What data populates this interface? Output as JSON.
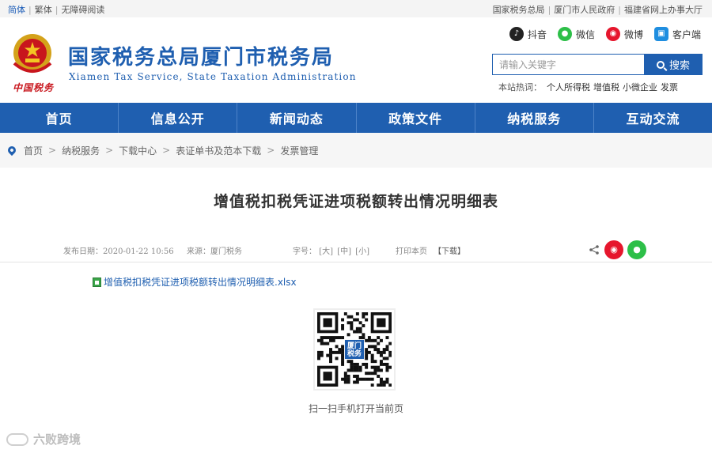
{
  "topbar": {
    "left_links": [
      "简体",
      "繁体",
      "无障碍阅读"
    ],
    "right_links": [
      "国家税务总局",
      "厦门市人民政府",
      "福建省网上办事大厅"
    ]
  },
  "header": {
    "emblem_text": "中国税务",
    "site_title": "国家税务总局厦门市税务局",
    "site_subtitle": "Xiamen Tax Service, State Taxation Administration",
    "social": [
      {
        "label": "抖音",
        "icon": "douyin-icon"
      },
      {
        "label": "微信",
        "icon": "wechat-icon"
      },
      {
        "label": "微博",
        "icon": "weibo-icon"
      },
      {
        "label": "客户端",
        "icon": "client-app-icon"
      }
    ],
    "search": {
      "placeholder": "请输入关键字",
      "button_label": "搜索"
    },
    "hot": {
      "label": "本站热词：",
      "terms": [
        "个人所得税",
        "增值税",
        "小微企业",
        "发票"
      ]
    }
  },
  "nav": {
    "items": [
      "首页",
      "信息公开",
      "新闻动态",
      "政策文件",
      "纳税服务",
      "互动交流"
    ]
  },
  "breadcrumb": [
    "首页",
    "纳税服务",
    "下载中心",
    "表证单书及范本下载",
    "发票管理"
  ],
  "article": {
    "title": "增值税扣税凭证进项税额转出情况明细表",
    "publish_date": "发布日期：2020-01-22 10:56",
    "source": "来源：厦门税务",
    "font_size_label": "字号：",
    "font_sizes": [
      "[大]",
      "[中]",
      "[小]"
    ],
    "print": "打印本页",
    "download": "【下载】",
    "attachment": "增值税扣税凭证进项税额转出情况明细表.xlsx",
    "qr_center": [
      "厦门",
      "税务"
    ],
    "qr_label": "扫一扫手机打开当前页"
  },
  "watermark": "六败跨境",
  "colors": {
    "brand_blue": "#1f5fb0",
    "emblem_red": "#c8161d",
    "wechat_green": "#2dbf48",
    "weibo_red": "#e6162d"
  }
}
